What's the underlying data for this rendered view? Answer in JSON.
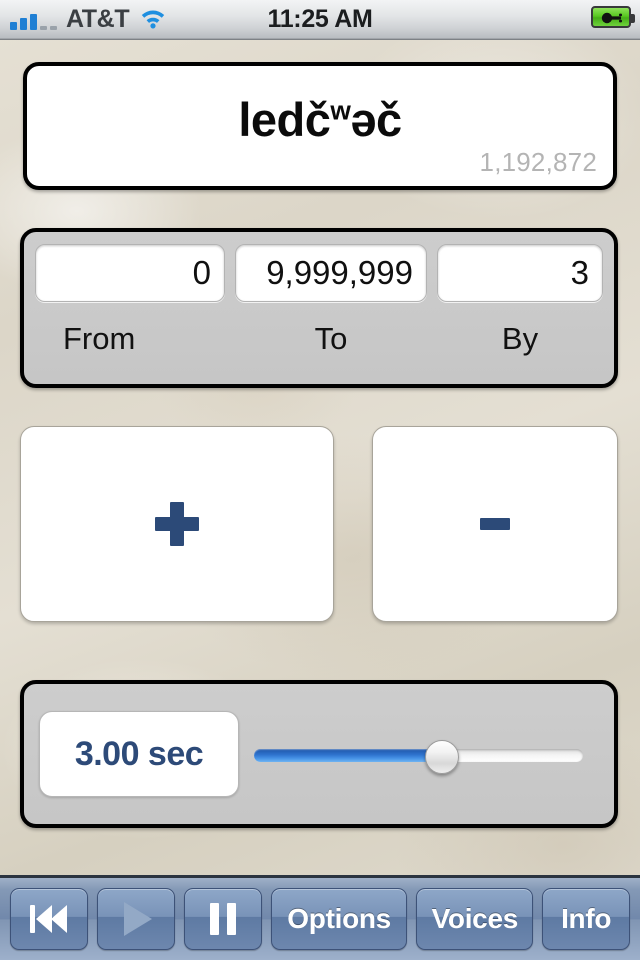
{
  "status_bar": {
    "carrier": "AT&T",
    "time": "11:25 AM",
    "signal_bars_filled": 3,
    "signal_bars_total": 5,
    "wifi_icon": "wifi-icon",
    "battery_icon": "battery-charging-icon",
    "battery_color": "#58c821"
  },
  "word_display": {
    "word_prefix": "ledč",
    "word_superscript": "w",
    "word_suffix": "əč",
    "word_full": "ledčʷəč",
    "counter": "1,192,872",
    "counter_color": "#b4b4b4"
  },
  "range_panel": {
    "from": {
      "value": "0",
      "label": "From"
    },
    "to": {
      "value": "9,999,999",
      "label": "To"
    },
    "by": {
      "value": "3",
      "label": "By"
    }
  },
  "step_buttons": {
    "plus_label": "+",
    "minus_label": "-",
    "glyph_color": "#2c4a78"
  },
  "speed_panel": {
    "value_text": "3.00 sec",
    "value_color": "#2d4a78",
    "slider_percent": 57,
    "slider_fill_color": "#2f74cf"
  },
  "toolbar": {
    "rewind_label": "rewind-icon",
    "play_label": "play-icon",
    "play_enabled": false,
    "pause_label": "pause-icon",
    "options_label": "Options",
    "voices_label": "Voices",
    "info_label": "Info",
    "button_color": "#7993b8"
  }
}
